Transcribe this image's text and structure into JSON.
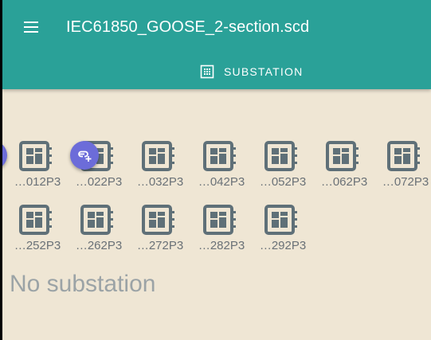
{
  "header": {
    "title": "IEC61850_GOOSE_2-section.scd",
    "menu_icon": "menu-icon",
    "tab": {
      "label": "SUBSTATION",
      "icon": "dashboard-grid-icon"
    }
  },
  "ieds": [
    {
      "label": "…012P3"
    },
    {
      "label": "…022P3"
    },
    {
      "label": "…032P3"
    },
    {
      "label": "…042P3"
    },
    {
      "label": "…052P3"
    },
    {
      "label": "…062P3"
    },
    {
      "label": "…072P3"
    },
    {
      "label": "…252P3"
    },
    {
      "label": "…262P3"
    },
    {
      "label": "…272P3"
    },
    {
      "label": "…282P3"
    },
    {
      "label": "…292P3"
    }
  ],
  "fabs": {
    "link_icon": "link-add-icon"
  },
  "empty_state": {
    "text": "No substation"
  },
  "colors": {
    "header": "#2aa198",
    "background": "#efe6d4",
    "fab": "#6c6cd9",
    "ied_icon": "#5f7078"
  }
}
